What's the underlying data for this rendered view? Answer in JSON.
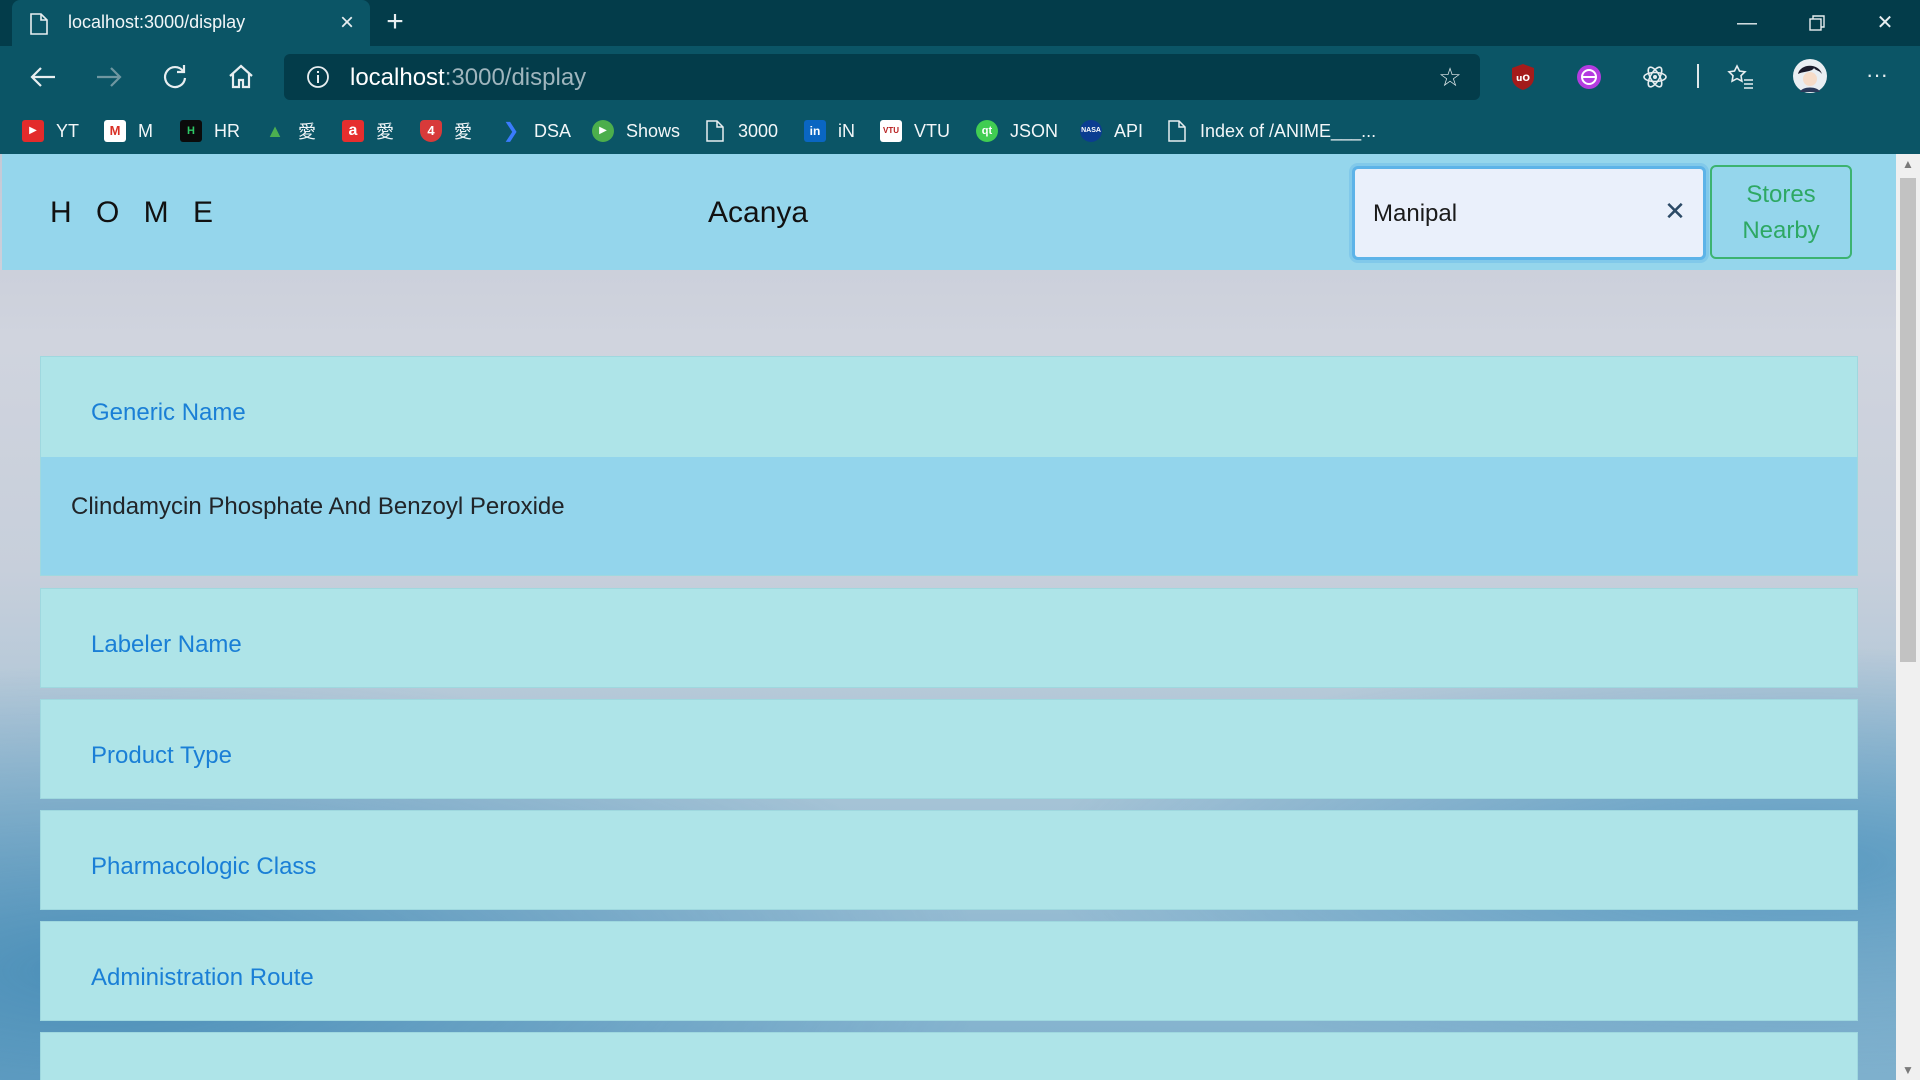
{
  "browser": {
    "tab_title": "localhost:3000/display",
    "url_host": "localhost",
    "url_path": ":3000/display",
    "bookmarks": [
      {
        "label": "YT",
        "icon": "youtube-icon"
      },
      {
        "label": "M",
        "icon": "gmail-icon"
      },
      {
        "label": "HR",
        "icon": "hackerrank-icon"
      },
      {
        "label": "愛",
        "icon": "anime-green-icon"
      },
      {
        "label": "愛",
        "icon": "anime-red-a-icon"
      },
      {
        "label": "愛",
        "icon": "anime-shield-icon"
      },
      {
        "label": "DSA",
        "icon": "dsa-icon"
      },
      {
        "label": "Shows",
        "icon": "play-icon"
      },
      {
        "label": "3000",
        "icon": "page-icon"
      },
      {
        "label": "iN",
        "icon": "linkedin-icon"
      },
      {
        "label": "VTU",
        "icon": "vtu-icon"
      },
      {
        "label": "JSON",
        "icon": "qt-icon"
      },
      {
        "label": "API",
        "icon": "nasa-icon"
      },
      {
        "label": "Index of /ANIME___...",
        "icon": "page-icon"
      }
    ]
  },
  "site": {
    "home_label": "H O M E",
    "brand": "Acanya",
    "search_value": "Manipal",
    "stores_button": [
      "Stores",
      "Nearby"
    ]
  },
  "cards": [
    {
      "title": "Generic Name",
      "value": "Clindamycin Phosphate And Benzoyl Peroxide"
    },
    {
      "title": "Labeler Name"
    },
    {
      "title": "Product Type"
    },
    {
      "title": "Pharmacologic Class"
    },
    {
      "title": "Administration Route"
    },
    {
      "title": ""
    }
  ],
  "colors": {
    "chrome": "#0b5566",
    "tabstrip": "#033c4a",
    "header": "#95d6ec",
    "card": "#aee4e8",
    "card_body": "#93d5ec",
    "card_title": "#1a7fd6",
    "stores_button": "#2ea864"
  }
}
